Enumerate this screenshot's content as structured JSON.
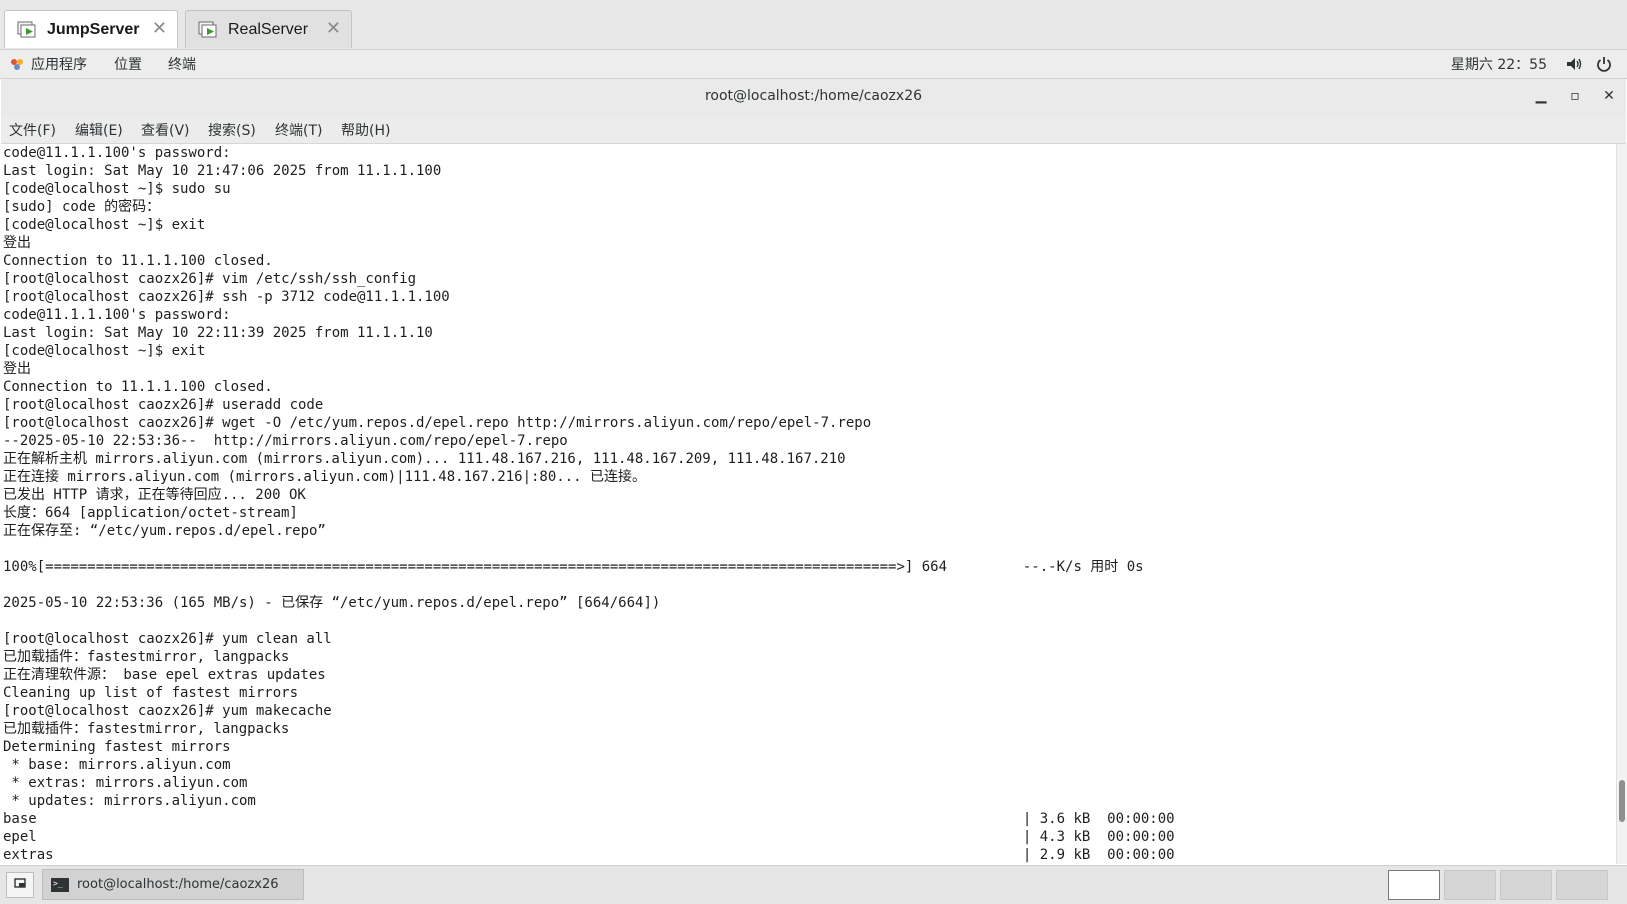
{
  "vm_tabs": [
    {
      "label": "JumpServer",
      "active": true
    },
    {
      "label": "RealServer",
      "active": false
    }
  ],
  "top_bar": {
    "menus": [
      "应用程序",
      "位置",
      "终端"
    ],
    "clock": "星期六 22：55",
    "icons": [
      "apps-logo-icon",
      "volume-icon",
      "power-icon"
    ]
  },
  "window": {
    "title": "root@localhost:/home/caozx26",
    "controls": [
      "minimize",
      "maximize",
      "close"
    ]
  },
  "menu_bar": [
    "文件(F)",
    "编辑(E)",
    "查看(V)",
    "搜索(S)",
    "终端(T)",
    "帮助(H)"
  ],
  "terminal": {
    "lines": [
      "code@11.1.1.100's password:",
      "Last login: Sat May 10 21:47:06 2025 from 11.1.1.100",
      "[code@localhost ~]$ sudo su",
      "[sudo] code 的密码：",
      "[code@localhost ~]$ exit",
      "登出",
      "Connection to 11.1.1.100 closed.",
      "[root@localhost caozx26]# vim /etc/ssh/ssh_config",
      "[root@localhost caozx26]# ssh -p 3712 code@11.1.1.100",
      "code@11.1.1.100's password:",
      "Last login: Sat May 10 22:11:39 2025 from 11.1.1.10",
      "[code@localhost ~]$ exit",
      "登出",
      "Connection to 11.1.1.100 closed.",
      "[root@localhost caozx26]# useradd code",
      "[root@localhost caozx26]# wget -O /etc/yum.repos.d/epel.repo http://mirrors.aliyun.com/repo/epel-7.repo",
      "--2025-05-10 22:53:36--  http://mirrors.aliyun.com/repo/epel-7.repo",
      "正在解析主机 mirrors.aliyun.com (mirrors.aliyun.com)... 111.48.167.216, 111.48.167.209, 111.48.167.210",
      "正在连接 mirrors.aliyun.com (mirrors.aliyun.com)|111.48.167.216|:80... 已连接。",
      "已发出 HTTP 请求，正在等待回应... 200 OK",
      "长度：664 [application/octet-stream]",
      "正在保存至: “/etc/yum.repos.d/epel.repo”",
      "",
      "100%[=====================================================================================================>] 664         --.-K/s 用时 0s",
      "",
      "2025-05-10 22:53:36 (165 MB/s) - 已保存 “/etc/yum.repos.d/epel.repo” [664/664])",
      "",
      "[root@localhost caozx26]# yum clean all",
      "已加载插件：fastestmirror, langpacks",
      "正在清理软件源： base epel extras updates",
      "Cleaning up list of fastest mirrors",
      "[root@localhost caozx26]# yum makecache",
      "已加载插件：fastestmirror, langpacks",
      "Determining fastest mirrors",
      " * base: mirrors.aliyun.com",
      " * extras: mirrors.aliyun.com",
      " * updates: mirrors.aliyun.com",
      "base                                                                                                                     | 3.6 kB  00:00:00",
      "epel                                                                                                                     | 4.3 kB  00:00:00",
      "extras                                                                                                                   | 2.9 kB  00:00:00"
    ]
  },
  "taskbar": {
    "task_label": "root@localhost:/home/caozx26",
    "workspaces": 4,
    "active_workspace": 1
  },
  "colors": {
    "vm_icon_green": "#3c9a2e",
    "terminal_bg": "#ffffff",
    "terminal_fg": "#1e1e1e"
  }
}
